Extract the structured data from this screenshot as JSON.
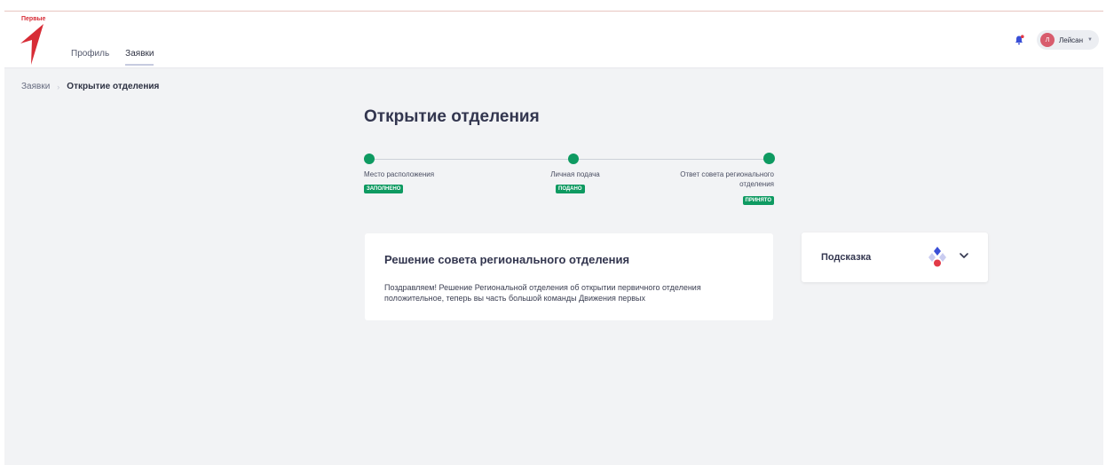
{
  "header": {
    "logo_text": "Первые",
    "nav": [
      {
        "label": "Профиль",
        "active": false
      },
      {
        "label": "Заявки",
        "active": true
      }
    ],
    "user": {
      "initial": "Л",
      "name": "Лейсан"
    }
  },
  "breadcrumb": {
    "parent": "Заявки",
    "current": "Открытие отделения"
  },
  "page": {
    "title": "Открытие отделения"
  },
  "steps": [
    {
      "label": "Место расположения",
      "badge": "ЗАПОЛНЕНО"
    },
    {
      "label": "Личная подача",
      "badge": "ПОДАНО"
    },
    {
      "label": "Ответ совета регионального отделения",
      "badge": "ПРИНЯТО"
    }
  ],
  "decision": {
    "title": "Решение совета регионального отделения",
    "text": "Поздравляем! Решение Региональной отделения об открытии первичного отделения положительное, теперь вы часть большой команды Движения первых"
  },
  "hint": {
    "title": "Подсказка"
  },
  "colors": {
    "accent_green": "#0e9a61",
    "brand_red": "#d72c36",
    "background": "#f2f3f5"
  },
  "icons": [
    "logo-icon",
    "bell-icon",
    "caret-down-icon",
    "movement-logo-icon",
    "chevron-down-icon"
  ]
}
